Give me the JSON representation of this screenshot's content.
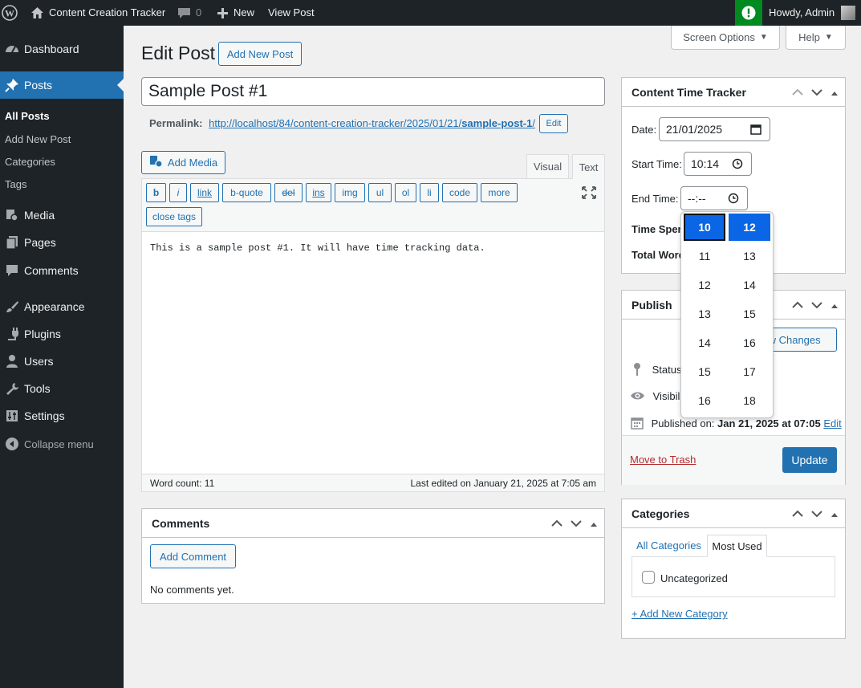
{
  "adminbar": {
    "site_name": "Content Creation Tracker",
    "comments_count": "0",
    "new_label": "New",
    "view_post": "View Post",
    "howdy": "Howdy, Admin"
  },
  "menu": {
    "dashboard": "Dashboard",
    "posts": "Posts",
    "sub_all_posts": "All Posts",
    "sub_add_new": "Add New Post",
    "sub_categories": "Categories",
    "sub_tags": "Tags",
    "media": "Media",
    "pages": "Pages",
    "comments": "Comments",
    "appearance": "Appearance",
    "plugins": "Plugins",
    "users": "Users",
    "tools": "Tools",
    "settings": "Settings",
    "collapse": "Collapse menu"
  },
  "screen_options": "Screen Options",
  "help": "Help",
  "page_title": "Edit Post",
  "add_new_post": "Add New Post",
  "post_title": "Sample Post #1",
  "permalink": {
    "label": "Permalink:",
    "url_base": "http://localhost/84/content-creation-tracker/2025/01/21/",
    "slug": "sample-post-1",
    "slash": "/",
    "edit": "Edit"
  },
  "editor": {
    "add_media": "Add Media",
    "tab_visual": "Visual",
    "tab_text": "Text",
    "quicktags": [
      "b",
      "i",
      "link",
      "b-quote",
      "del",
      "ins",
      "img",
      "ul",
      "ol",
      "li",
      "code",
      "more"
    ],
    "close_tags": "close tags",
    "content": "This is a sample post #1. It will have time tracking data.",
    "word_count": "Word count: 11",
    "last_edited": "Last edited on January 21, 2025 at 7:05 am"
  },
  "comments_box": {
    "title": "Comments",
    "add_comment": "Add Comment",
    "empty": "No comments yet."
  },
  "tracker": {
    "title": "Content Time Tracker",
    "date_label": "Date:",
    "date_value": "21/01/2025",
    "start_label": "Start Time:",
    "start_value": "10:14",
    "end_label": "End Time:",
    "end_value": "--:--",
    "time_spent_label": "Time Spen",
    "total_words_label": "Total Word"
  },
  "time_picker": {
    "hours": [
      "10",
      "11",
      "12",
      "13",
      "14",
      "15",
      "16"
    ],
    "minutes": [
      "12",
      "13",
      "14",
      "15",
      "16",
      "17",
      "18"
    ],
    "selected_hour": "10",
    "selected_minute": "12"
  },
  "publish": {
    "title": "Publish",
    "preview_changes": "ew Changes",
    "status_label": "Status:",
    "visibility_label": "Visibili",
    "published_on_label": "Published on:",
    "published_on_value": "Jan 21, 2025 at 07:05",
    "edit": "Edit",
    "move_to_trash": "Move to Trash",
    "update": "Update"
  },
  "categories": {
    "title": "Categories",
    "tab_all": "All Categories",
    "tab_most_used": "Most Used",
    "item": "Uncategorized",
    "add_new": "+ Add New Category"
  }
}
